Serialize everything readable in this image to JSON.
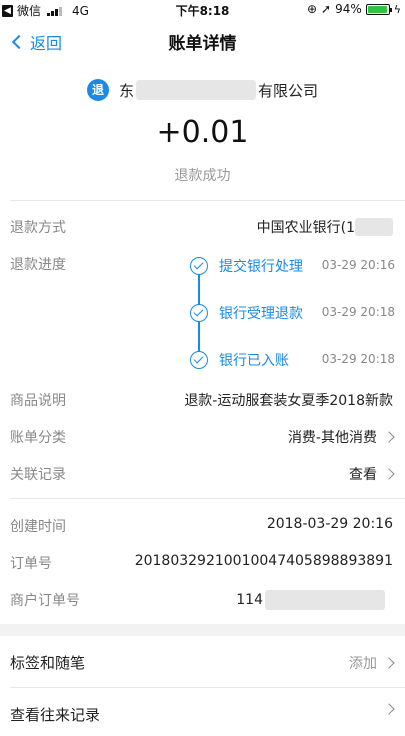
{
  "status_bar": {
    "carrier": "微信",
    "network": "4G",
    "time": "下午8:18",
    "battery": "94%",
    "battery_level": 0.94
  },
  "nav": {
    "back_label": "返回",
    "title": "账单详情"
  },
  "header": {
    "badge": "退",
    "merchant_prefix": "东",
    "merchant_suffix": "有限公司",
    "amount": "+0.01",
    "status": "退款成功"
  },
  "details": {
    "refund_method": {
      "label": "退款方式",
      "value": "中国农业银行(1"
    },
    "progress_label": "退款进度",
    "progress_steps": [
      {
        "label": "提交银行处理",
        "time": "03-29 20:16"
      },
      {
        "label": "银行受理退款",
        "time": "03-29 20:18"
      },
      {
        "label": "银行已入账",
        "time": "03-29 20:18"
      }
    ],
    "product": {
      "label": "商品说明",
      "value": "退款-运动服套装女夏季2018新款"
    },
    "category": {
      "label": "账单分类",
      "value": "消费-其他消费"
    },
    "related": {
      "label": "关联记录",
      "value": "查看"
    },
    "created": {
      "label": "创建时间",
      "value": "2018-03-29 20:16"
    },
    "order_no": {
      "label": "订单号",
      "value": "20180329210010047405898893891"
    },
    "merchant_order_no": {
      "label": "商户订单号",
      "value": "114"
    }
  },
  "footer": {
    "tags": {
      "label": "标签和随笔",
      "value": "添加"
    },
    "history": {
      "label": "查看往来记录"
    }
  }
}
